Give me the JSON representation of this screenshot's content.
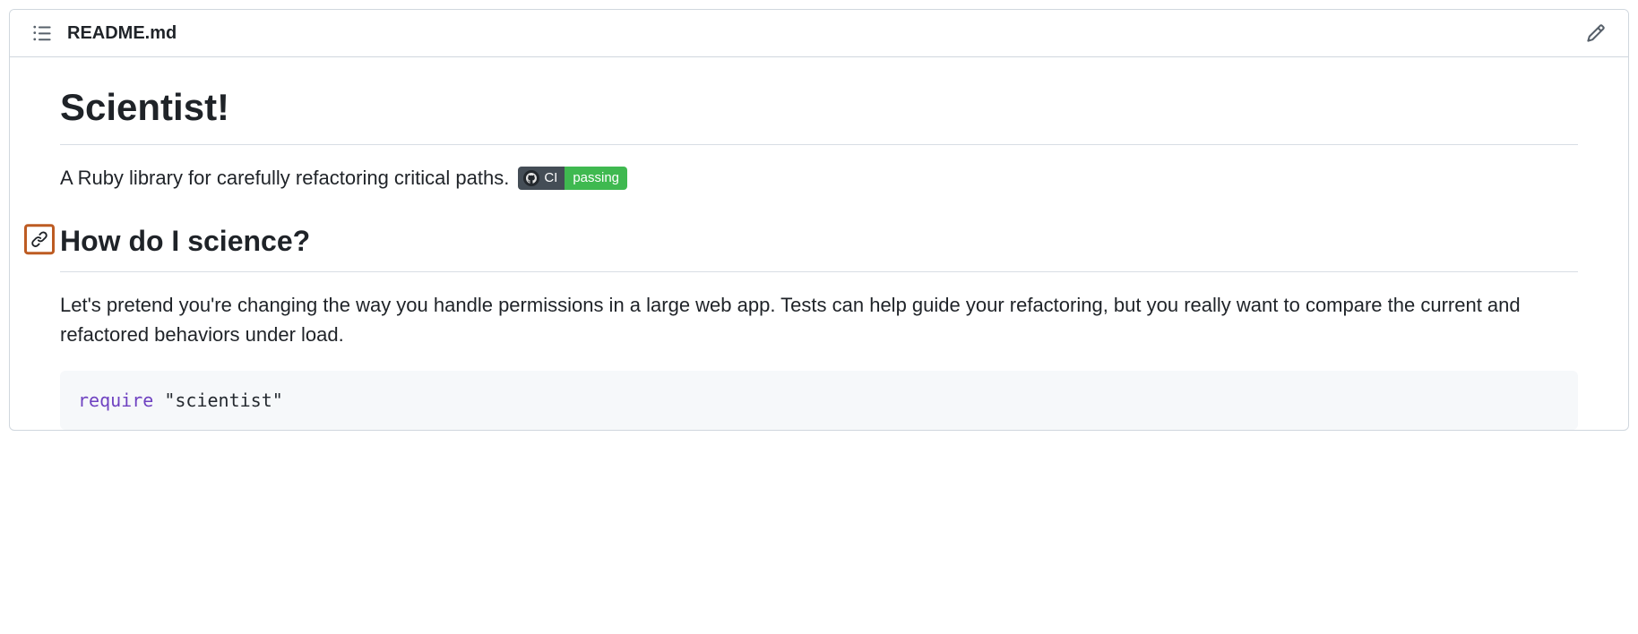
{
  "header": {
    "filename": "README.md"
  },
  "content": {
    "h1": "Scientist!",
    "description": "A Ruby library for carefully refactoring critical paths.",
    "badge": {
      "left": "CI",
      "right": "passing"
    },
    "h2": "How do I science?",
    "paragraph": "Let's pretend you're changing the way you handle permissions in a large web app. Tests can help guide your refactoring, but you really want to compare the current and refactored behaviors under load.",
    "code": {
      "keyword": "require",
      "string": "\"scientist\""
    }
  }
}
